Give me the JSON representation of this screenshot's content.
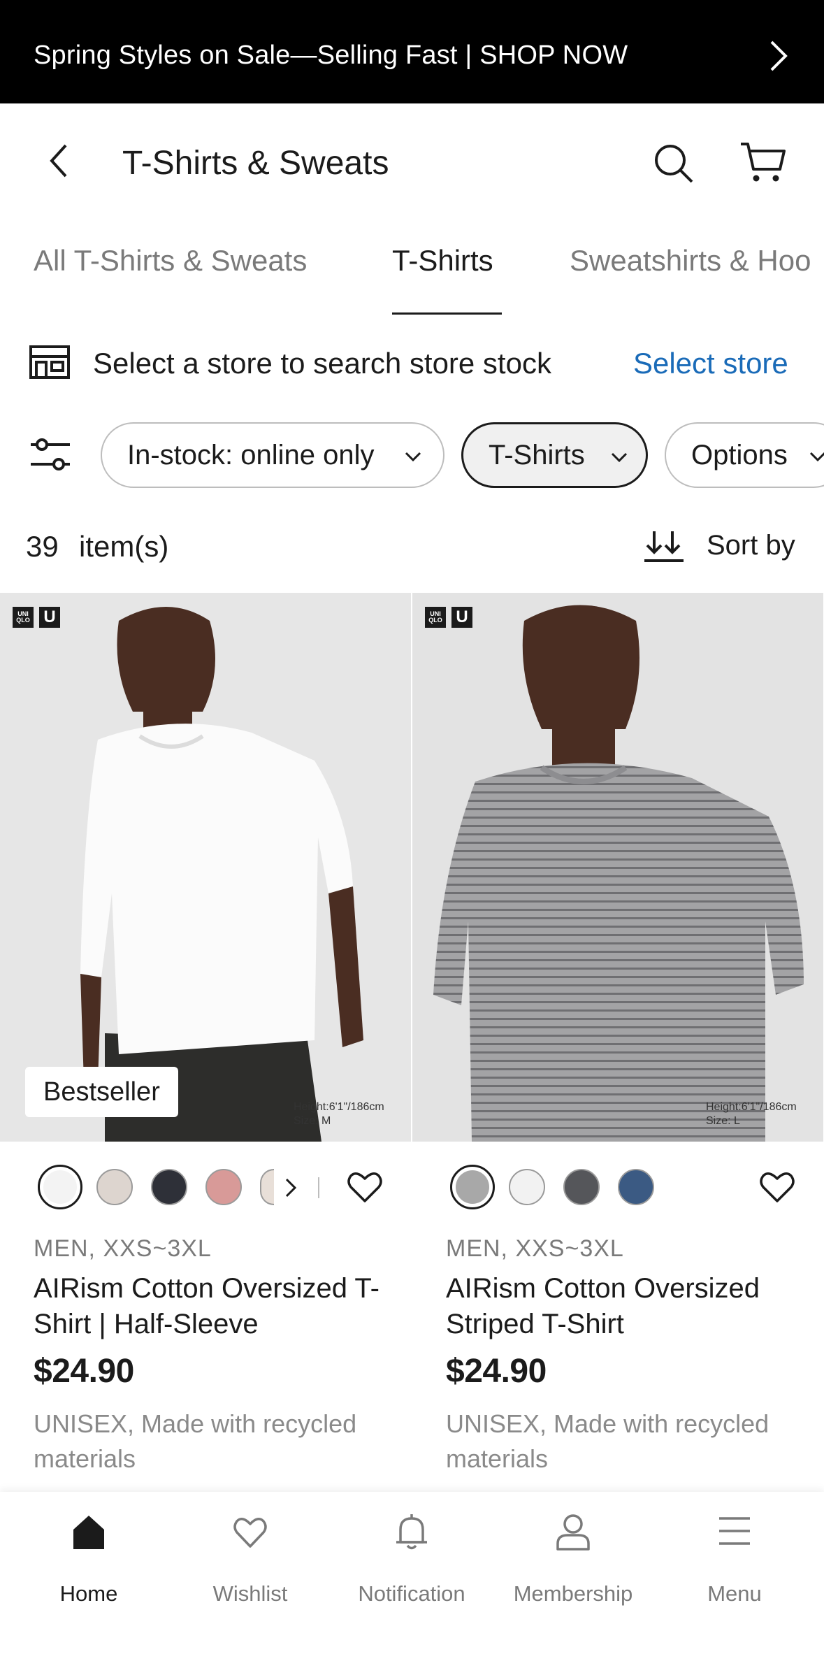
{
  "promo": {
    "text": "Spring Styles on Sale—Selling Fast | SHOP NOW"
  },
  "header": {
    "title": "T-Shirts & Sweats"
  },
  "tabs": [
    {
      "label": "All T-Shirts & Sweats",
      "active": false
    },
    {
      "label": "T-Shirts",
      "active": true
    },
    {
      "label": "Sweatshirts & Hoo",
      "active": false
    }
  ],
  "store": {
    "text": "Select a store to search store stock",
    "link": "Select store"
  },
  "filters": [
    {
      "label": "In-stock: online only",
      "selected": false
    },
    {
      "label": "T-Shirts",
      "selected": true
    },
    {
      "label": "Options",
      "selected": false
    }
  ],
  "results": {
    "count": "39",
    "label": "item(s)",
    "sort_label": "Sort by"
  },
  "colors": {
    "link": "#1a6bb8",
    "text": "#1b1b1b",
    "muted": "#7a7a7a"
  },
  "products": [
    {
      "badge": "Bestseller",
      "model_note": [
        "Height:6'1\"/186cm",
        "Size: M"
      ],
      "swatches": [
        "#f3f3f3",
        "#ddd5cf",
        "#2e3038",
        "#d89a98",
        "#e8dfd8"
      ],
      "meta": "MEN, XXS~3XL",
      "name": "AIRism Cotton Oversized T-Shirt | Half-Sleeve",
      "price": "$24.90",
      "note": "UNISEX, Made with recycled materials"
    },
    {
      "badge": "",
      "model_note": [
        "Height:6'1\"/186cm",
        "Size: L"
      ],
      "swatches": [
        "#a8a8a8",
        "#f2f2f2",
        "#55565a",
        "#3b5a83"
      ],
      "meta": "MEN, XXS~3XL",
      "name": "AIRism Cotton Oversized Striped T-Shirt",
      "price": "$24.90",
      "note": "UNISEX, Made with recycled materials"
    }
  ],
  "logo": {
    "uniqlo_line1": "UNI",
    "uniqlo_line2": "QLO",
    "u": "U"
  },
  "bottom_nav": [
    {
      "label": "Home",
      "icon": "home-icon",
      "active": true
    },
    {
      "label": "Wishlist",
      "icon": "heart-icon",
      "active": false
    },
    {
      "label": "Notification",
      "icon": "bell-icon",
      "active": false
    },
    {
      "label": "Membership",
      "icon": "person-icon",
      "active": false
    },
    {
      "label": "Menu",
      "icon": "menu-icon",
      "active": false
    }
  ]
}
